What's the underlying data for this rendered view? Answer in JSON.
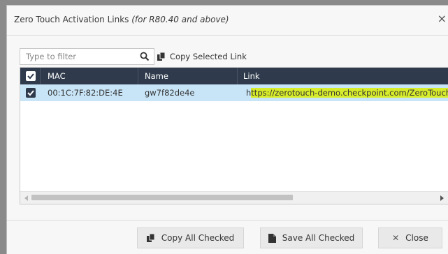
{
  "dialog": {
    "title": "Zero Touch Activation Links",
    "subtitle": "(for R80.40 and above)",
    "close_icon": "×"
  },
  "toolbar": {
    "filter_placeholder": "Type to filter",
    "copy_selected_label": "Copy Selected Link"
  },
  "table": {
    "columns": [
      "MAC",
      "Name",
      "Link"
    ],
    "rows": [
      {
        "checked": true,
        "mac": "00:1C:7F:82:DE:4E",
        "name": "gw7f82de4e",
        "link_prefix": "h",
        "link_highlighted": "ttps://zerotouch-demo.checkpoint.com/ZeroTouch"
      }
    ]
  },
  "footer": {
    "copy_all_label": "Copy All Checked",
    "save_all_label": "Save All Checked",
    "close_label": "Close",
    "close_icon": "✕"
  },
  "colors": {
    "header_bg": "#2f3b4c",
    "selected_row": "#c8e5f7",
    "link_highlight": "#d7ec2a"
  }
}
